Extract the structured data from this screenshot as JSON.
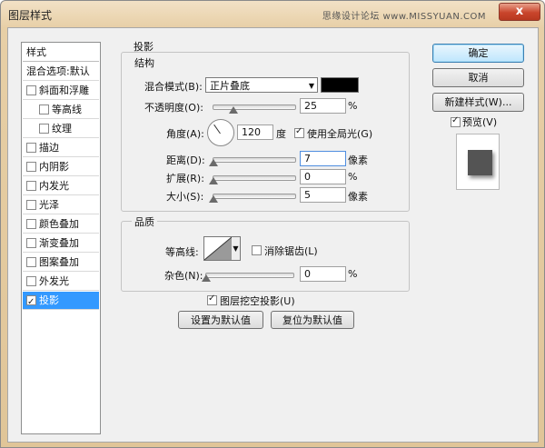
{
  "window": {
    "title": "图层样式",
    "watermark": "思缘设计论坛 www.MISSYUAN.COM",
    "close_glyph": "x"
  },
  "sidebar": {
    "header": "样式",
    "items": [
      {
        "label": "混合选项:默认",
        "checkbox": false,
        "checked": false,
        "selected": false,
        "indent": false
      },
      {
        "label": "斜面和浮雕",
        "checkbox": true,
        "checked": false,
        "selected": false,
        "indent": false
      },
      {
        "label": "等高线",
        "checkbox": true,
        "checked": false,
        "selected": false,
        "indent": true
      },
      {
        "label": "纹理",
        "checkbox": true,
        "checked": false,
        "selected": false,
        "indent": true
      },
      {
        "label": "描边",
        "checkbox": true,
        "checked": false,
        "selected": false,
        "indent": false
      },
      {
        "label": "内阴影",
        "checkbox": true,
        "checked": false,
        "selected": false,
        "indent": false
      },
      {
        "label": "内发光",
        "checkbox": true,
        "checked": false,
        "selected": false,
        "indent": false
      },
      {
        "label": "光泽",
        "checkbox": true,
        "checked": false,
        "selected": false,
        "indent": false
      },
      {
        "label": "颜色叠加",
        "checkbox": true,
        "checked": false,
        "selected": false,
        "indent": false
      },
      {
        "label": "渐变叠加",
        "checkbox": true,
        "checked": false,
        "selected": false,
        "indent": false
      },
      {
        "label": "图案叠加",
        "checkbox": true,
        "checked": false,
        "selected": false,
        "indent": false
      },
      {
        "label": "外发光",
        "checkbox": true,
        "checked": false,
        "selected": false,
        "indent": false
      },
      {
        "label": "投影",
        "checkbox": true,
        "checked": true,
        "selected": true,
        "indent": false
      }
    ]
  },
  "drop_shadow": {
    "section_title": "投影",
    "structure": {
      "title": "结构",
      "blend_mode_label": "混合模式(B):",
      "blend_mode_value": "正片叠底",
      "shadow_color": "#000000",
      "opacity_label": "不透明度(O):",
      "opacity_value": "25",
      "opacity_fraction": 0.25,
      "percent_unit": "%",
      "angle_label": "角度(A):",
      "angle_value": "120",
      "angle_unit": "度",
      "global_light_label": "使用全局光(G)",
      "global_light_checked": true,
      "distance_label": "距离(D):",
      "distance_value": "7",
      "distance_unit": "像素",
      "spread_label": "扩展(R):",
      "spread_value": "0",
      "spread_unit": "%",
      "size_label": "大小(S):",
      "size_value": "5",
      "size_unit": "像素"
    },
    "quality": {
      "title": "品质",
      "contour_label": "等高线:",
      "anti_aliased_label": "消除锯齿(L)",
      "anti_aliased_checked": false,
      "noise_label": "杂色(N):",
      "noise_value": "0",
      "noise_unit": "%"
    },
    "knockout_label": "图层挖空投影(U)",
    "knockout_checked": true,
    "make_default_label": "设置为默认值",
    "reset_default_label": "复位为默认值"
  },
  "buttons": {
    "ok": "确定",
    "cancel": "取消",
    "new_style": "新建样式(W)...",
    "preview_label": "预览(V)",
    "preview_checked": true
  },
  "colors": {
    "selected_bg": "#3399ff",
    "preview_fill": "#545454",
    "title_bar": "#e7cfa6"
  }
}
